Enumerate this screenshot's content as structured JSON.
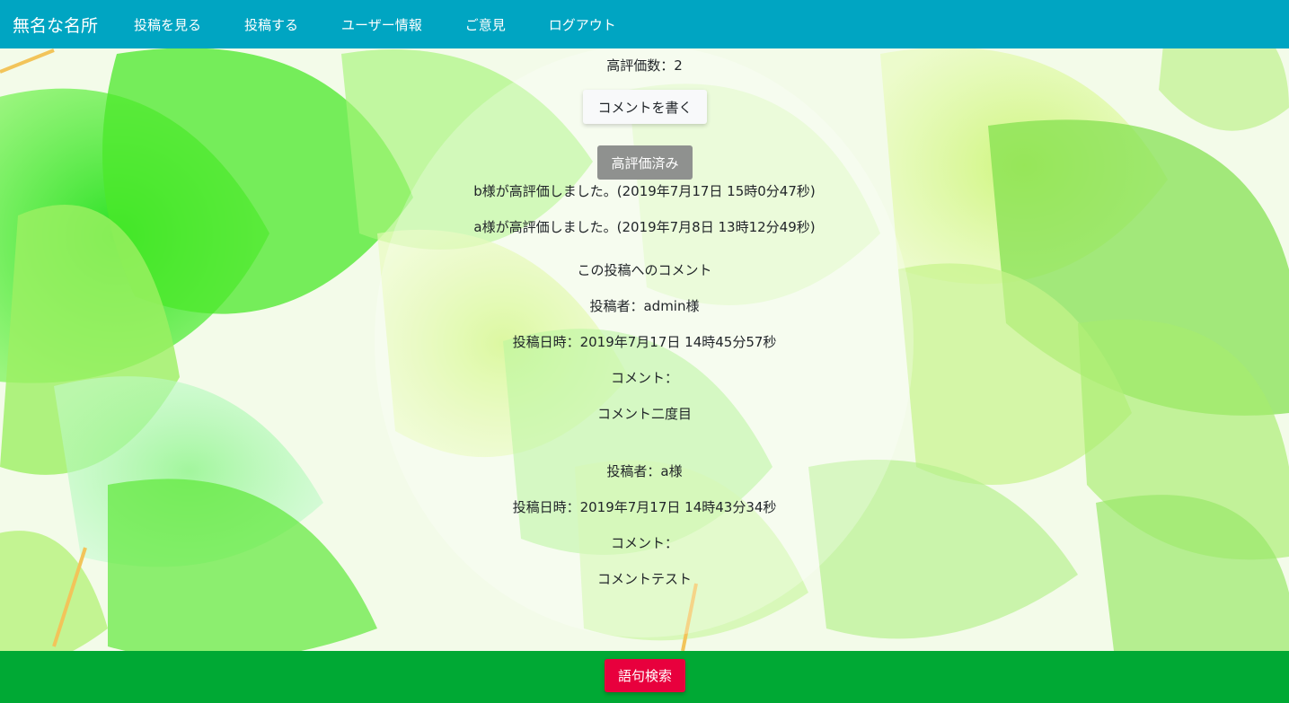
{
  "navbar": {
    "brand": "無名な名所",
    "items": [
      {
        "label": "投稿を見る"
      },
      {
        "label": "投稿する"
      },
      {
        "label": "ユーザー情報"
      },
      {
        "label": "ご意見"
      },
      {
        "label": "ログアウト"
      }
    ]
  },
  "post": {
    "likes_text": "高評価数：2",
    "write_comment_label": "コメントを書く",
    "rated_label": "高評価済み",
    "ratings": [
      "b様が高評価しました。(2019年7月17日 15時0分47秒)",
      "a様が高評価しました。(2019年7月8日 13時12分49秒)"
    ]
  },
  "comments": {
    "heading": "この投稿へのコメント",
    "items": [
      {
        "author": "投稿者：admin様",
        "datetime": "投稿日時：2019年7月17日 14時45分57秒",
        "comment_label": "コメント：",
        "body": "コメント二度目"
      },
      {
        "author": "投稿者：a様",
        "datetime": "投稿日時：2019年7月17日 14時43分34秒",
        "comment_label": "コメント：",
        "body": "コメントテスト"
      }
    ]
  },
  "footer": {
    "search_label": "語句検索"
  },
  "colors": {
    "navbar": "#00a5c2",
    "footer": "#00a934",
    "search_button": "#e8003d",
    "rated_button": "#8f918f"
  }
}
